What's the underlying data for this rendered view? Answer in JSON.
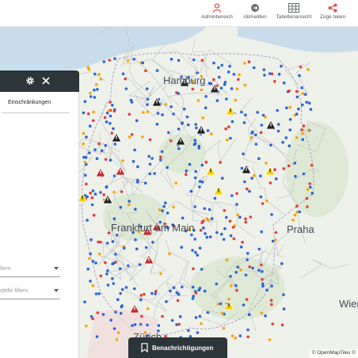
{
  "header": {
    "admin_label": "Adminbereich",
    "logout_label": "Abmelden",
    "table_label": "Tabellenansicht",
    "share_label": "Züge teilen",
    "accent_color": "#d9534f"
  },
  "panel": {
    "tab_label": "Einschränkungen",
    "filter1_placeholder": "ltern",
    "filter2_placeholder": "stelle filtern",
    "settings_icon": "gear-icon",
    "close_icon": "close-icon"
  },
  "map": {
    "cities": [
      "Hamburg",
      "Frankfurt am Main",
      "Praha",
      "Wien",
      "Zürich"
    ],
    "attribution": "© OpenMapTiles ©"
  },
  "notify_button": {
    "label": "Benachrichtigungen",
    "icon": "bookmark-icon"
  }
}
